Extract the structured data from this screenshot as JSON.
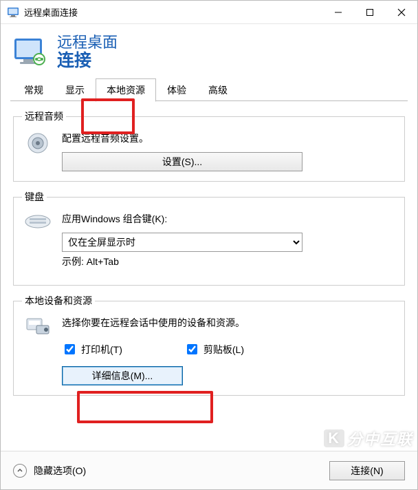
{
  "titlebar": {
    "title": "远程桌面连接"
  },
  "header": {
    "line1": "远程桌面",
    "line2": "连接"
  },
  "tabs": {
    "items": [
      {
        "label": "常规"
      },
      {
        "label": "显示"
      },
      {
        "label": "本地资源"
      },
      {
        "label": "体验"
      },
      {
        "label": "高级"
      }
    ],
    "active_index": 2
  },
  "groups": {
    "audio": {
      "legend": "远程音频",
      "text": "配置远程音频设置。",
      "button": "设置(S)..."
    },
    "keyboard": {
      "legend": "键盘",
      "text": "应用Windows 组合键(K):",
      "selected": "仅在全屏显示时",
      "example": "示例: Alt+Tab"
    },
    "local": {
      "legend": "本地设备和资源",
      "text": "选择你要在远程会话中使用的设备和资源。",
      "printer": "打印机(T)",
      "clipboard": "剪贴板(L)",
      "more": "详细信息(M)..."
    }
  },
  "footer": {
    "hide_options": "隐藏选项(O)",
    "connect": "连接(N)"
  },
  "watermark": {
    "k": "K",
    "text": "分中互联"
  }
}
